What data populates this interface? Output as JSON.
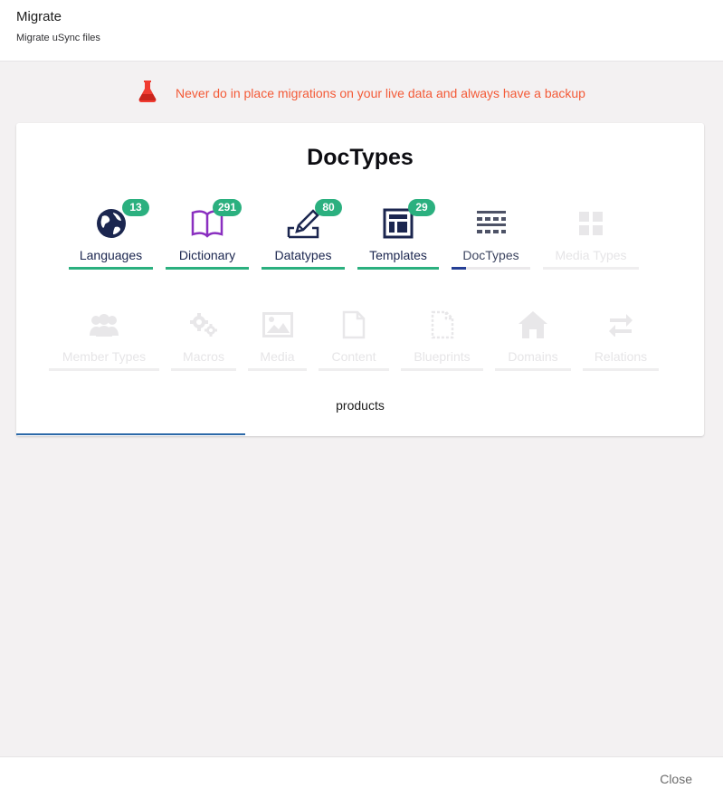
{
  "header": {
    "title": "Migrate",
    "subtitle": "Migrate uSync files"
  },
  "warning": {
    "text": "Never do in place migrations on your live data and always have a backup",
    "color": "#f35a37",
    "icon": "flask-icon"
  },
  "card": {
    "title": "DocTypes",
    "current_item": "products",
    "progress_fraction": 0.333
  },
  "steps_row1": [
    {
      "label": "Languages",
      "badge": "13",
      "icon": "globe-icon",
      "state": "done"
    },
    {
      "label": "Dictionary",
      "badge": "291",
      "icon": "book-icon",
      "state": "done"
    },
    {
      "label": "Datatypes",
      "badge": "80",
      "icon": "pen-icon",
      "state": "done"
    },
    {
      "label": "Templates",
      "badge": "29",
      "icon": "template-icon",
      "state": "done"
    },
    {
      "label": "DocTypes",
      "icon": "doctype-icon",
      "state": "current"
    },
    {
      "label": "Media Types",
      "icon": "grid-icon",
      "state": "future"
    }
  ],
  "steps_row2": [
    {
      "label": "Member Types",
      "icon": "users-icon",
      "state": "future"
    },
    {
      "label": "Macros",
      "icon": "gears-icon",
      "state": "future"
    },
    {
      "label": "Media",
      "icon": "image-icon",
      "state": "future"
    },
    {
      "label": "Content",
      "icon": "document-icon",
      "state": "future"
    },
    {
      "label": "Blueprints",
      "icon": "blueprint-icon",
      "state": "future"
    },
    {
      "label": "Domains",
      "icon": "home-icon",
      "state": "future"
    },
    {
      "label": "Relations",
      "icon": "arrows-icon",
      "state": "future"
    }
  ],
  "footer": {
    "close_label": "Close"
  },
  "colors": {
    "done": "#2bb07f",
    "current": "#253f95",
    "accent_text": "#1b264f"
  }
}
